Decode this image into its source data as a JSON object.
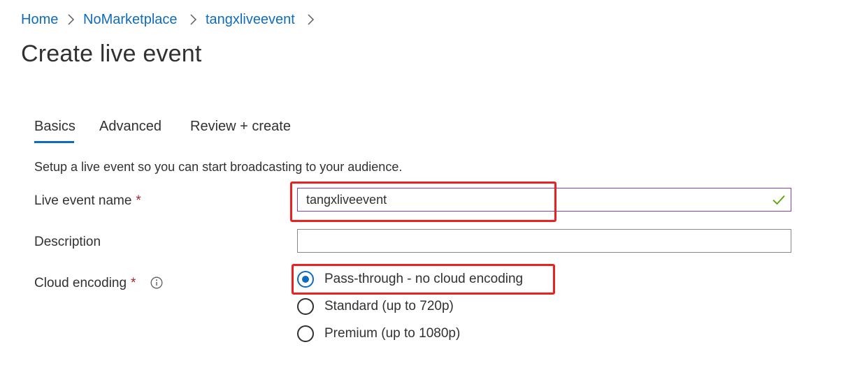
{
  "breadcrumb": {
    "items": [
      {
        "label": "Home"
      },
      {
        "label": "NoMarketplace"
      },
      {
        "label": "tangxliveevent"
      }
    ]
  },
  "page": {
    "title": "Create live event"
  },
  "tabs": [
    {
      "label": "Basics",
      "active": true
    },
    {
      "label": "Advanced",
      "active": false
    },
    {
      "label": "Review + create",
      "active": false
    }
  ],
  "form": {
    "intro": "Setup a live event so you can start broadcasting to your audience.",
    "required_marker": "*",
    "live_event_name": {
      "label": "Live event name",
      "value": "tangxliveevent",
      "valid": true
    },
    "description": {
      "label": "Description",
      "value": ""
    },
    "cloud_encoding": {
      "label": "Cloud encoding",
      "options": [
        {
          "label": "Pass-through - no cloud encoding",
          "selected": true
        },
        {
          "label": "Standard (up to 720p)",
          "selected": false
        },
        {
          "label": "Premium (up to 1080p)",
          "selected": false
        }
      ]
    }
  },
  "colors": {
    "link": "#0f6cbd",
    "accent": "#0f6cbd",
    "required": "#a4262c",
    "valid_check": "#57a300",
    "focused_border": "#8a3dab",
    "annotation": "#e8231f"
  },
  "icons": {
    "breadcrumb_separator": "chevron-right-icon",
    "info": "info-icon",
    "valid": "checkmark-icon"
  }
}
